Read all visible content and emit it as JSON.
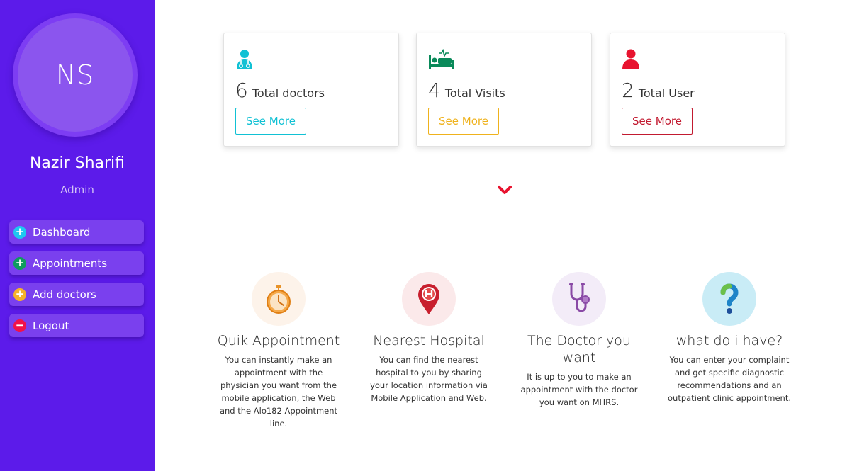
{
  "sidebar": {
    "avatar_initials": "NS",
    "user_name": "Nazir Sharifi",
    "user_role": "Admin",
    "items": [
      {
        "label": "Dashboard",
        "icon": "plus-circle-icon",
        "color": "#1ec8f0"
      },
      {
        "label": "Appointments",
        "icon": "plus-circle-icon",
        "color": "#0f9b5e"
      },
      {
        "label": "Add doctors",
        "icon": "plus-circle-icon",
        "color": "#f5b22a"
      },
      {
        "label": "Logout",
        "icon": "minus-circle-icon",
        "color": "#f0124a"
      }
    ]
  },
  "cards": [
    {
      "count": "6",
      "label": "Total doctors",
      "button": "See More",
      "icon": "doctor-icon",
      "color": "#11c1d4"
    },
    {
      "count": "4",
      "label": "Total Visits",
      "button": "See More",
      "icon": "hospital-bed-icon",
      "color": "#0a8a5a",
      "button_color": "#efb21d"
    },
    {
      "count": "2",
      "label": "Total User",
      "button": "See More",
      "icon": "user-icon",
      "color": "#e8132f",
      "button_color": "#c21a30"
    }
  ],
  "scroll_indicator": {
    "icon": "chevron-down-icon",
    "color": "#e8132f"
  },
  "features": [
    {
      "title": "Quik Appointment",
      "description": "You can instantly make an appointment with the physician you want from the mobile application, the Web and the Alo182 Appointment line.",
      "icon": "stopwatch-icon",
      "bg": "#fdf3ea"
    },
    {
      "title": "Nearest Hospital",
      "description": "You can find the nearest hospital to you by sharing your location information via Mobile Application and Web.",
      "icon": "hospital-pin-icon",
      "bg": "#fbe9ea"
    },
    {
      "title": "The Doctor you want",
      "description": "It is up to you to make an appointment with the doctor you want on MHRS.",
      "icon": "stethoscope-icon",
      "bg": "#f3ecf8"
    },
    {
      "title": "what do i have?",
      "description": "You can enter your complaint and get specific diagnostic recommendations and an outpatient clinic appointment.",
      "icon": "question-mark-icon",
      "bg": "#c9ecf6"
    }
  ]
}
